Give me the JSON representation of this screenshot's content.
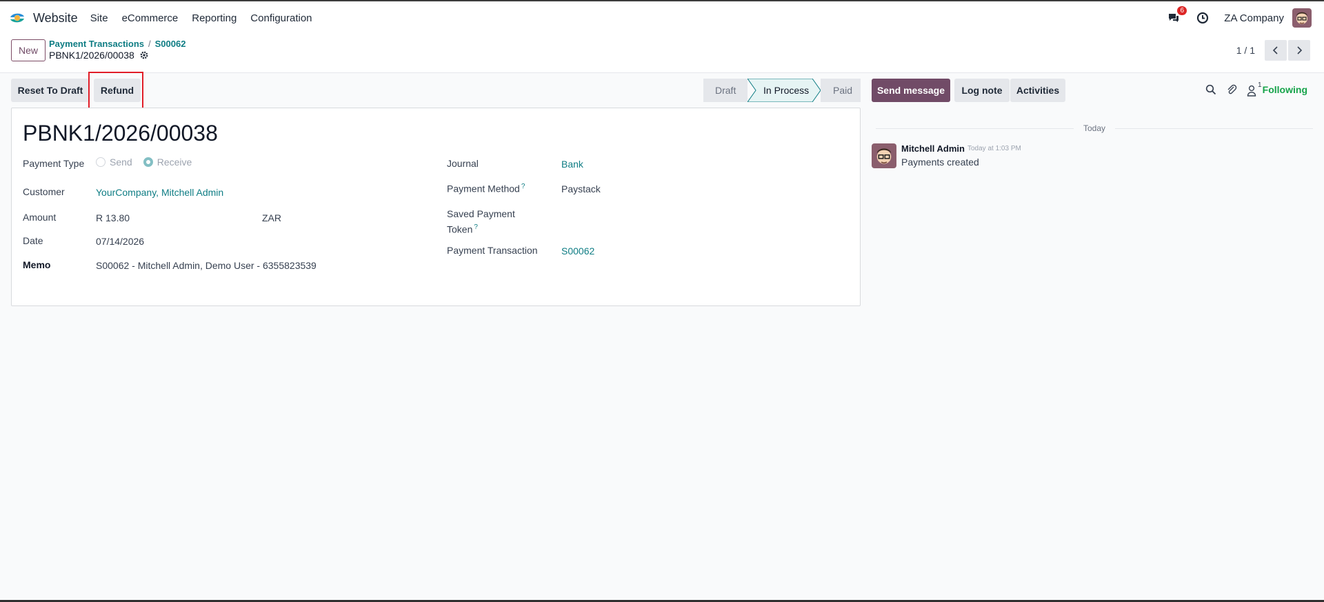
{
  "navbar": {
    "app_name": "Website",
    "menu": [
      "Site",
      "eCommerce",
      "Reporting",
      "Configuration"
    ],
    "messages_badge": "6",
    "company": "ZA Company"
  },
  "control_panel": {
    "new_label": "New",
    "breadcrumb": [
      "Payment Transactions",
      "S00062"
    ],
    "record_name": "PBNK1/2026/00038",
    "pager_value": "1 / 1"
  },
  "statusbar": {
    "reset_label": "Reset To Draft",
    "refund_label": "Refund",
    "stages": [
      "Draft",
      "In Process",
      "Paid"
    ],
    "active_stage": "In Process"
  },
  "form": {
    "title": "PBNK1/2026/00038",
    "payment_type_label": "Payment Type",
    "payment_type_options": [
      "Send",
      "Receive"
    ],
    "payment_type_value": "Receive",
    "customer_label": "Customer",
    "customer_value": "YourCompany, Mitchell Admin",
    "amount_label": "Amount",
    "amount_value": "R 13.80",
    "currency_value": "ZAR",
    "date_label": "Date",
    "date_value": "07/14/2026",
    "memo_label": "Memo",
    "memo_value": "S00062 - Mitchell Admin, Demo User - 6355823539",
    "journal_label": "Journal",
    "journal_value": "Bank",
    "payment_method_label": "Payment Method",
    "payment_method_value": "Paystack",
    "saved_token_label_line1": "Saved Payment",
    "saved_token_label_line2": "Token",
    "payment_transaction_label": "Payment Transaction",
    "payment_transaction_value": "S00062",
    "help_mark": "?"
  },
  "chatter": {
    "send_message_label": "Send message",
    "log_note_label": "Log note",
    "activities_label": "Activities",
    "followers_count": "1",
    "following_label": "Following",
    "date_separator": "Today",
    "message": {
      "author": "Mitchell Admin",
      "time": "Today at 1:03 PM",
      "body": "Payments created"
    }
  },
  "colors": {
    "brand": "#714b67",
    "link": "#0f7d84",
    "following": "#16a34a",
    "badge": "#dc2626",
    "highlight": "#e11d28"
  },
  "icons": [
    "app-logo-icon",
    "chat-icon",
    "clock-icon",
    "avatar",
    "gear-icon",
    "chevron-left-icon",
    "chevron-right-icon",
    "search-icon",
    "paperclip-icon",
    "follower-icon"
  ]
}
